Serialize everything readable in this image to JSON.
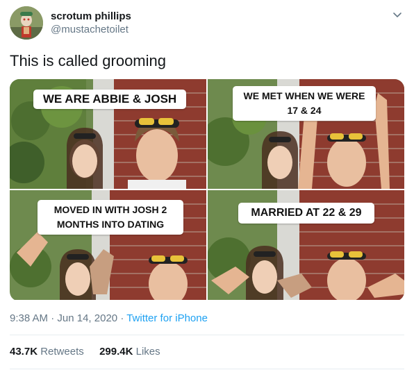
{
  "user": {
    "display_name": "scrotum phillips",
    "handle": "@mustachetoilet"
  },
  "tweet": {
    "text": "This is called grooming",
    "time": "9:38 AM",
    "separator": "·",
    "date": "Jun 14, 2020",
    "source": "Twitter for iPhone"
  },
  "media": {
    "captions": [
      "WE ARE ABBIE & JOSH",
      "WE MET WHEN WE WERE\n17 & 24",
      "MOVED IN WITH JOSH 2\nMONTHS INTO DATING",
      "MARRIED AT 22 & 29"
    ]
  },
  "stats": {
    "retweets_count": "43.7K",
    "retweets_label": "Retweets",
    "likes_count": "299.4K",
    "likes_label": "Likes"
  },
  "icons": {
    "avatar": "avatar-image",
    "caret": "chevron-down-icon"
  },
  "colors": {
    "link": "#1da1f2",
    "secondary_text": "#657786",
    "primary_text": "#14171a",
    "divider": "#e6ecf0"
  }
}
